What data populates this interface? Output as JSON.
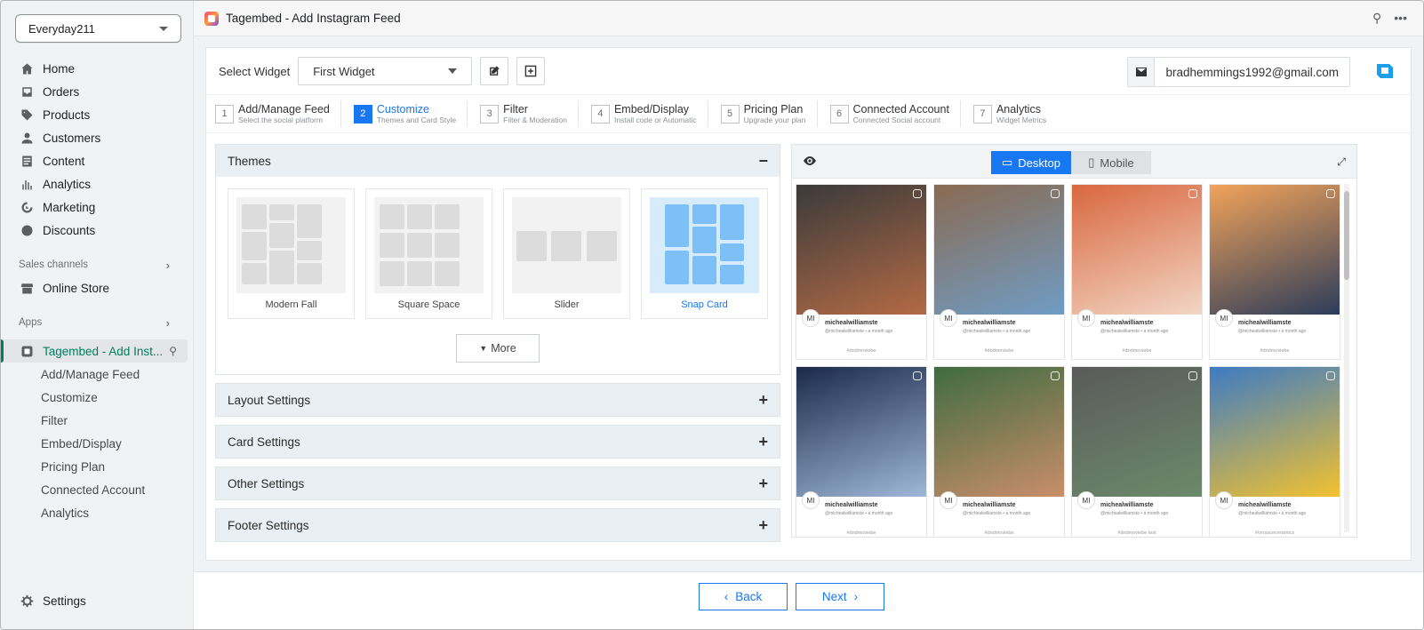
{
  "store": {
    "name": "Everyday211"
  },
  "nav": {
    "items": [
      {
        "label": "Home",
        "icon": "home-icon"
      },
      {
        "label": "Orders",
        "icon": "orders-icon"
      },
      {
        "label": "Products",
        "icon": "tag-icon"
      },
      {
        "label": "Customers",
        "icon": "person-icon"
      },
      {
        "label": "Content",
        "icon": "content-icon"
      },
      {
        "label": "Analytics",
        "icon": "bar-chart-icon"
      },
      {
        "label": "Marketing",
        "icon": "target-icon"
      },
      {
        "label": "Discounts",
        "icon": "discount-icon"
      }
    ],
    "sales_channels": "Sales channels",
    "online_store": "Online Store",
    "apps": "Apps",
    "app_item": "Tagembed - Add Inst...",
    "app_sub": [
      "Add/Manage Feed",
      "Customize",
      "Filter",
      "Embed/Display",
      "Pricing Plan",
      "Connected Account",
      "Analytics"
    ],
    "settings": "Settings"
  },
  "topbar": {
    "title": "Tagembed - Add Instagram Feed"
  },
  "widget": {
    "select_label": "Select Widget",
    "selected": "First Widget",
    "email": "bradhemmings1992@gmail.com"
  },
  "steps": [
    {
      "num": "1",
      "title": "Add/Manage Feed",
      "sub": "Select the social platform"
    },
    {
      "num": "2",
      "title": "Customize",
      "sub": "Themes and Card Style"
    },
    {
      "num": "3",
      "title": "Filter",
      "sub": "Filter & Moderation"
    },
    {
      "num": "4",
      "title": "Embed/Display",
      "sub": "Install code or Automatic"
    },
    {
      "num": "5",
      "title": "Pricing Plan",
      "sub": "Upgrade your plan"
    },
    {
      "num": "6",
      "title": "Connected Account",
      "sub": "Connected Social account"
    },
    {
      "num": "7",
      "title": "Analytics",
      "sub": "Widget Metrics"
    }
  ],
  "themes": {
    "title": "Themes",
    "items": [
      "Modern Fall",
      "Square Space",
      "Slider",
      "Snap Card"
    ],
    "more": "More"
  },
  "settings_sections": [
    "Layout Settings",
    "Card Settings",
    "Other Settings",
    "Footer Settings"
  ],
  "preview": {
    "desktop": "Desktop",
    "mobile": "Mobile",
    "cards": [
      {
        "avatar": "MI",
        "user": "michealwilliamste",
        "time": "@michealwilliamste • a month ago",
        "tag": "#dndmoviebe",
        "colors": [
          "#3a3a3a",
          "#b36a45"
        ]
      },
      {
        "avatar": "MI",
        "user": "michealwilliamste",
        "time": "@michealwilliamste • a month ago",
        "tag": "#dndmoviebe",
        "colors": [
          "#8a6a52",
          "#6f9cc4"
        ]
      },
      {
        "avatar": "MI",
        "user": "michealwilliamste",
        "time": "@michealwilliamste • a month ago",
        "tag": "#dndmoviebe",
        "colors": [
          "#d9673f",
          "#f2d6c4"
        ]
      },
      {
        "avatar": "MI",
        "user": "michealwilliamste",
        "time": "@michealwilliamste • a month ago",
        "tag": "#dndmoviebe",
        "colors": [
          "#f2a35a",
          "#2c3c5a"
        ]
      },
      {
        "avatar": "MI",
        "user": "michealwilliamste",
        "time": "@michealwilliamste • a month ago",
        "tag": "#dndmoviebe",
        "colors": [
          "#1b2a4a",
          "#9fb7d8"
        ]
      },
      {
        "avatar": "MI",
        "user": "michealwilliamste",
        "time": "@michealwilliamste • a month ago",
        "tag": "#dndmoviebe",
        "colors": [
          "#3f6b3f",
          "#c98e6b"
        ]
      },
      {
        "avatar": "MI",
        "user": "michealwilliamste",
        "time": "@michealwilliamste • a month ago",
        "tag": "#dndmoviebe test",
        "colors": [
          "#5a5a5a",
          "#6b8a6b"
        ]
      },
      {
        "avatar": "MI",
        "user": "michealwilliamste",
        "time": "@michealwilliamste • a month ago",
        "tag": "#versaceceramics",
        "colors": [
          "#3d7bc4",
          "#f2c230"
        ]
      }
    ]
  },
  "footer": {
    "back": "Back",
    "next": "Next"
  }
}
